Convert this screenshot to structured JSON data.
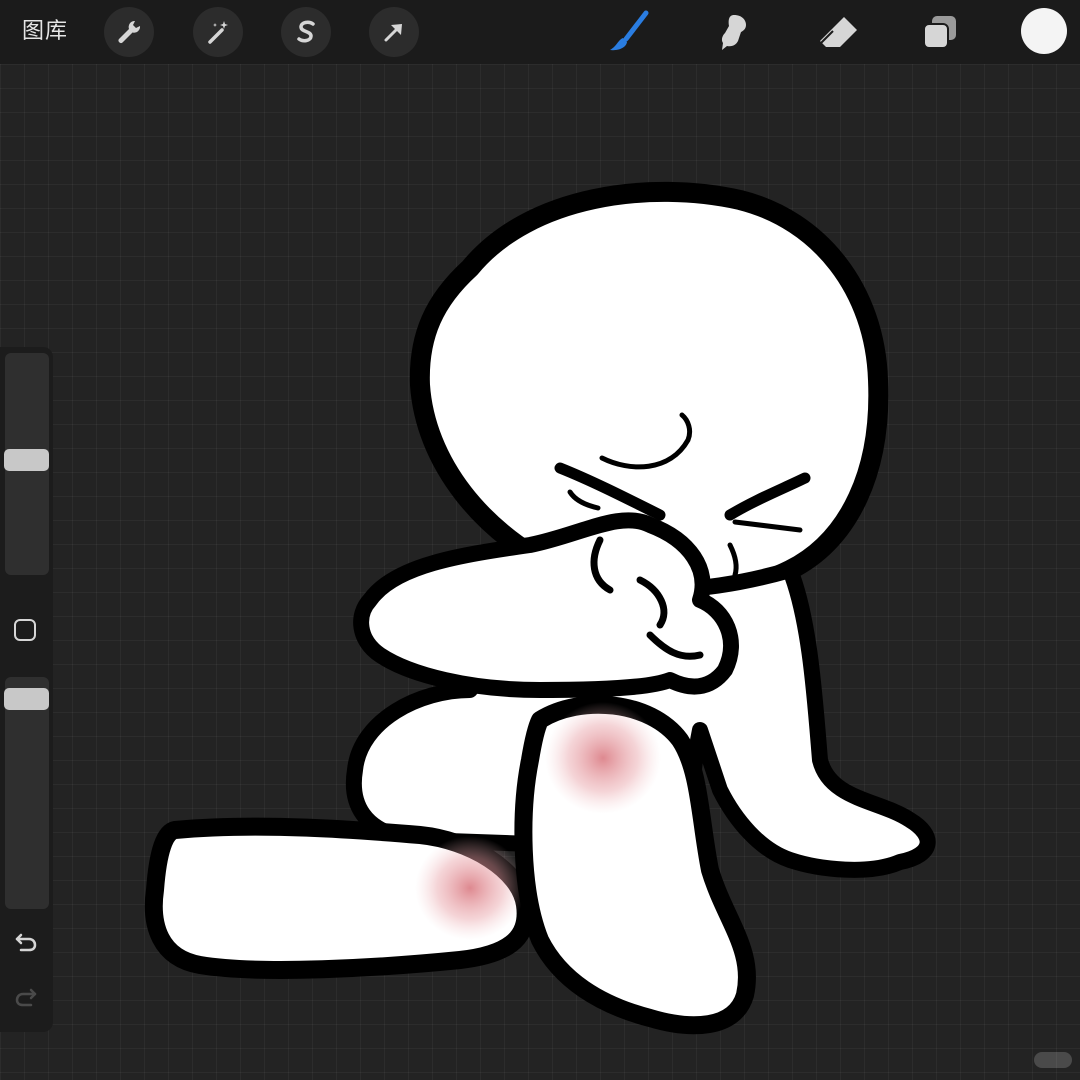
{
  "topbar": {
    "gallery_label": "图库",
    "left_tools": [
      {
        "name": "actions",
        "icon": "wrench-icon"
      },
      {
        "name": "adjustments",
        "icon": "magic-wand-icon"
      },
      {
        "name": "selection",
        "icon": "selection-s-icon"
      },
      {
        "name": "transform",
        "icon": "arrow-icon"
      }
    ],
    "right_tools": [
      {
        "name": "brush",
        "icon": "brush-icon",
        "active": true
      },
      {
        "name": "smudge",
        "icon": "smudge-icon"
      },
      {
        "name": "eraser",
        "icon": "eraser-icon"
      },
      {
        "name": "layers",
        "icon": "layers-icon"
      }
    ],
    "active_color": "#f4f4f4",
    "accent_color": "#2a7de1"
  },
  "sidebar": {
    "brush_size_level": 0.48,
    "opacity_level": 0.05,
    "buttons": [
      "modify-square",
      "undo",
      "redo"
    ]
  },
  "canvas": {
    "subject": "drawing",
    "background_color": "#232323"
  }
}
